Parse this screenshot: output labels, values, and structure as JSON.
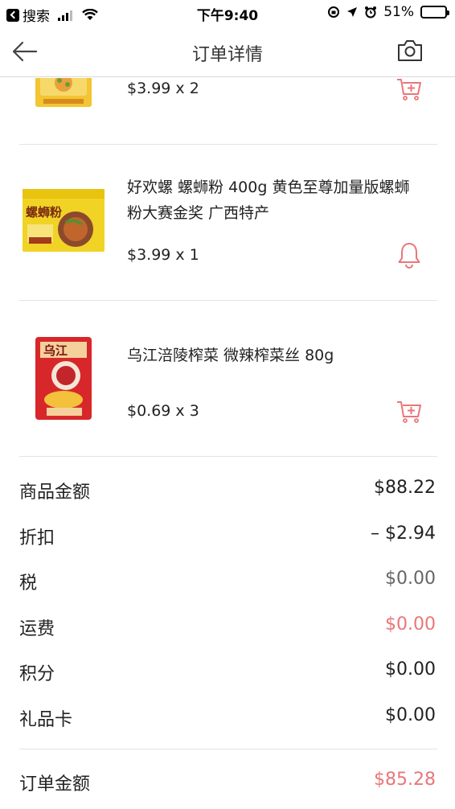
{
  "status_bar": {
    "back_app": "搜索",
    "time": "下午9:40",
    "battery": "51%",
    "battery_level": 0.51
  },
  "nav": {
    "title": "订单详情"
  },
  "items": [
    {
      "name": "",
      "price": "$3.99 x 2",
      "action_icon": "cart-plus-icon"
    },
    {
      "name": "好欢螺 螺蛳粉 400g 黄色至尊加量版螺蛳粉大赛金奖 广西特产",
      "price": "$3.99 x 1",
      "action_icon": "bell-icon"
    },
    {
      "name": "乌江涪陵榨菜 微辣榨菜丝 80g",
      "price": "$0.69 x 3",
      "action_icon": "cart-plus-icon"
    }
  ],
  "summary": [
    {
      "label": "商品金额",
      "value": "$88.22"
    },
    {
      "label": "折扣",
      "value": "– $2.94"
    },
    {
      "label": "税",
      "value": "$0.00"
    },
    {
      "label": "运费",
      "value": "$0.00"
    },
    {
      "label": "积分",
      "value": "$0.00"
    },
    {
      "label": "礼品卡",
      "value": "$0.00"
    }
  ],
  "total": {
    "label": "订单金额",
    "value": "$85.28"
  },
  "colors": {
    "accent": "#e8777a",
    "divider": "#e3e3e3"
  }
}
